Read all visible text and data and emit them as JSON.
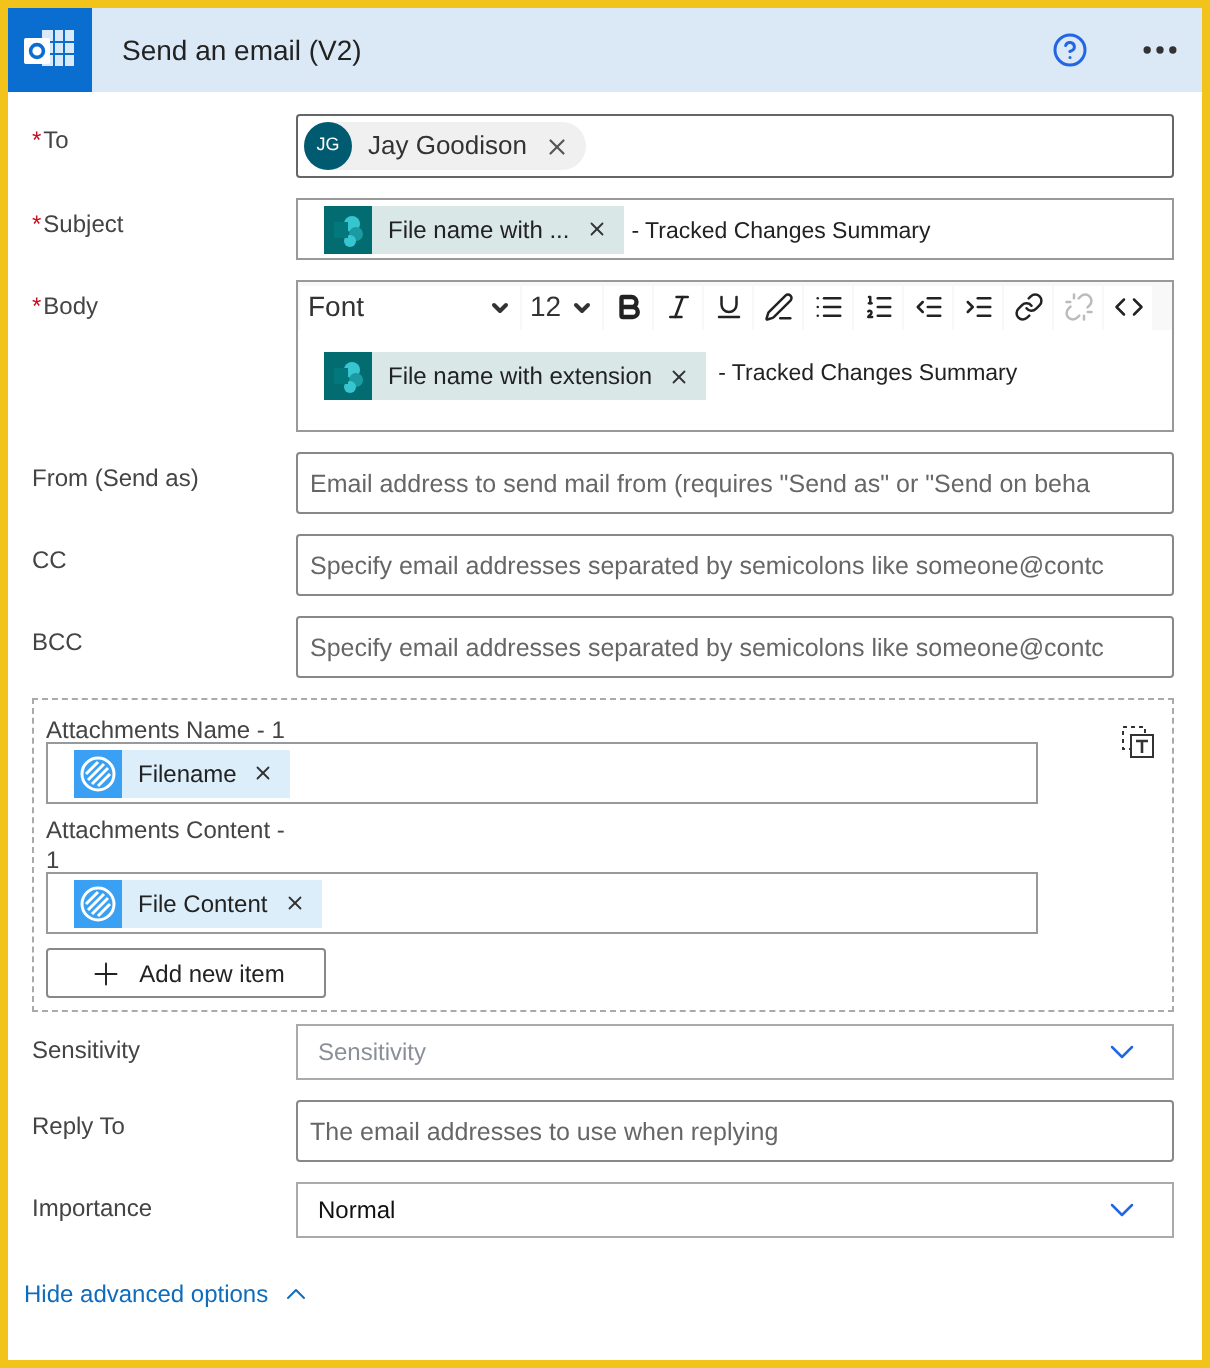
{
  "header": {
    "title": "Send an email (V2)"
  },
  "fields": [
    {
      "label": "To",
      "required_mark": "*",
      "kind": "recipient",
      "initials": "JG",
      "name": "Jay Goodison"
    },
    {
      "label": "Subject",
      "required_mark": "*",
      "kind": "tokens",
      "tokens": [
        {
          "kind": "sharepoint",
          "text": "File name with ..."
        }
      ],
      "text": "- Tracked Changes Summary"
    },
    {
      "label": "Body",
      "required_mark": "*",
      "kind": "rich",
      "font": "Font",
      "size": "12",
      "tools": [
        {
          "kind": "bold",
          "disabled": false
        },
        {
          "kind": "italic",
          "disabled": false
        },
        {
          "kind": "underline",
          "disabled": false
        },
        {
          "kind": "pen",
          "disabled": false
        },
        {
          "kind": "bullets",
          "disabled": false
        },
        {
          "kind": "numbers",
          "disabled": false
        },
        {
          "kind": "outdent",
          "disabled": false
        },
        {
          "kind": "indent",
          "disabled": false
        },
        {
          "kind": "link",
          "disabled": false
        },
        {
          "kind": "unlink",
          "disabled": true
        },
        {
          "kind": "code",
          "disabled": false
        }
      ],
      "tokens": [
        {
          "kind": "sharepoint",
          "text": "File name with extension"
        }
      ],
      "text": "- Tracked Changes Summary"
    },
    {
      "label": "From (Send as)",
      "kind": "text",
      "placeholder": "Email address to send mail from (requires \"Send as\" or \"Send on beha"
    },
    {
      "label": "CC",
      "kind": "text",
      "placeholder": "Specify email addresses separated by semicolons like someone@contc"
    },
    {
      "label": "BCC",
      "kind": "text",
      "placeholder": "Specify email addresses separated by semicolons like someone@contc"
    }
  ],
  "attachments": {
    "items": [
      {
        "label": "Attachments Name - 1",
        "token": {
          "kind": "variable",
          "text": "Filename"
        }
      },
      {
        "label": "Attachments Content - 1",
        "token": {
          "kind": "variable",
          "text": "File Content"
        }
      }
    ],
    "add_button": "Add new item"
  },
  "more_fields": [
    {
      "label": "Sensitivity",
      "kind": "dropdown",
      "placeholder": "Sensitivity"
    },
    {
      "label": "Reply To",
      "kind": "text",
      "placeholder": "The email addresses to use when replying"
    },
    {
      "label": "Importance",
      "kind": "dropdown",
      "value": "Normal"
    }
  ],
  "footer_link": "Hide advanced options"
}
